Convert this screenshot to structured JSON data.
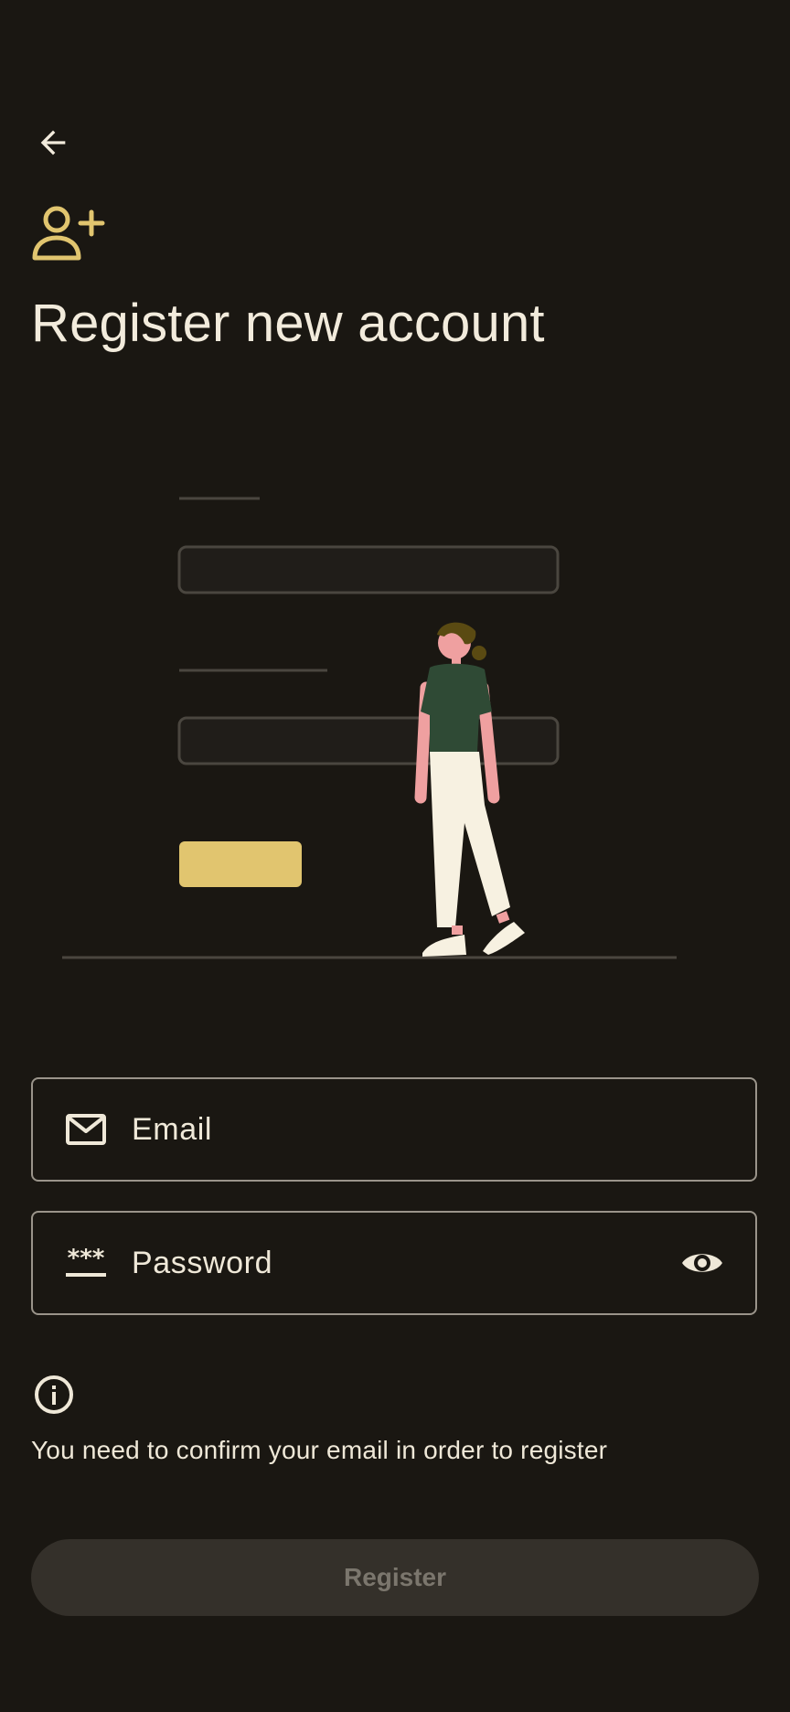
{
  "page": {
    "title": "Register new account"
  },
  "form": {
    "email_label": "Email",
    "password_label": "Password"
  },
  "info": {
    "text": "You need to confirm your email in order to register"
  },
  "actions": {
    "register_label": "Register"
  },
  "icons": {
    "back": "arrow-back-icon",
    "header": "person-add-icon",
    "email": "mail-icon",
    "password": "password-icon",
    "visibility": "eye-icon",
    "info": "info-icon"
  },
  "colors": {
    "background": "#1a1712",
    "accent": "#e1c56f",
    "text": "#f2ebdc",
    "outline": "#9a948a",
    "button_disabled_bg": "#34302a",
    "button_disabled_text": "#7b766d"
  }
}
